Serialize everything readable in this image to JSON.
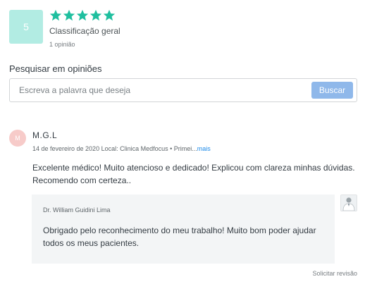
{
  "summary": {
    "score": "5",
    "star_count": 5,
    "star_color": "#1fbf9f",
    "label": "Classificação geral",
    "count_text": "1 opinião"
  },
  "search": {
    "label": "Pesquisar em opiniões",
    "placeholder": "Escreva a palavra que deseja",
    "button": "Buscar"
  },
  "review": {
    "avatar_initial": "M",
    "author": "M.G.L",
    "meta": "14 de fevereiro de 2020 Local: Clinica Medfocus • Primei...",
    "more": "mais",
    "text": "Excelente médico! Muito atencioso e dedicado! Explicou com clareza minhas dúvidas. Recomendo com certeza..",
    "reply": {
      "author": "Dr. William Guidini Lima",
      "text": "Obrigado pelo reconhecimento do meu trabalho! Muito bom poder ajudar todos os meus pacientes."
    },
    "request_link": "Solicitar revisão"
  },
  "colors": {
    "accent_button": "#8fb8ea",
    "score_box": "#b2ece3",
    "avatar": "#f7cbc9",
    "link": "#1d8ae8"
  }
}
